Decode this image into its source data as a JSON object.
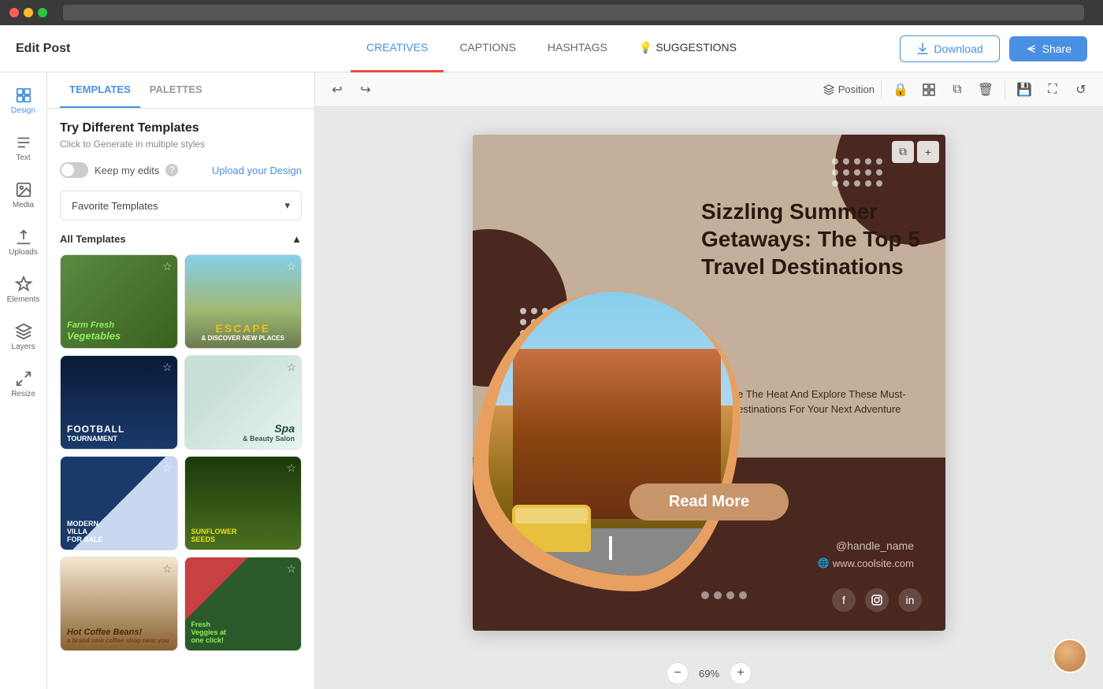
{
  "browser": {
    "dots": [
      "red",
      "yellow",
      "green"
    ]
  },
  "header": {
    "title": "Edit Post",
    "tabs": [
      {
        "label": "CREATIVES",
        "id": "creatives",
        "active": true
      },
      {
        "label": "CAPTIONS",
        "id": "captions",
        "active": false
      },
      {
        "label": "HASHTAGS",
        "id": "hashtags",
        "active": false
      },
      {
        "label": "SUGGESTIONS",
        "id": "suggestions",
        "active": false
      }
    ],
    "download_label": "Download",
    "share_label": "Share"
  },
  "left_panel": {
    "tabs": [
      {
        "label": "TEMPLATES",
        "active": true
      },
      {
        "label": "PALETTES",
        "active": false
      }
    ],
    "try_templates": {
      "title": "Try Different Templates",
      "subtitle": "Click to Generate in multiple styles"
    },
    "keep_edits_label": "Keep my edits",
    "upload_link": "Upload your Design",
    "dropdown": {
      "label": "Favorite Templates",
      "chevron": "▾"
    },
    "all_templates": {
      "label": "All Templates",
      "chevron": "▲"
    },
    "templates": [
      {
        "id": 1,
        "color": "t1",
        "label": "Farm Fresh\nVegetables",
        "star": "☆"
      },
      {
        "id": 2,
        "color": "t2",
        "label": "ESCAPE",
        "star": "☆"
      },
      {
        "id": 3,
        "color": "t3",
        "label": "FOOTBALL\nTOURNAMENT",
        "star": "☆"
      },
      {
        "id": 4,
        "color": "t4",
        "label": "Spa\n& Beauty Salon",
        "star": "☆"
      },
      {
        "id": 5,
        "color": "t5",
        "label": "MODERN\nVILLA\nFOR SALE",
        "star": "☆"
      },
      {
        "id": 6,
        "color": "t6",
        "label": "SUNFLOWER\nSEEDS",
        "star": "☆"
      },
      {
        "id": 7,
        "color": "t7",
        "label": "Hot Coffee Beans!",
        "star": "☆"
      },
      {
        "id": 8,
        "color": "t8",
        "label": "Fresh\nVeggies at\none click!",
        "star": "☆"
      }
    ]
  },
  "toolbar": {
    "position_label": "Position",
    "zoom": {
      "value": "69%",
      "minus": "−",
      "plus": "+"
    }
  },
  "design": {
    "title": "Sizzling Summer Getaways: The Top 5 Travel Destinations",
    "subtitle": "Escape The Heat And Explore These Must-See Destinations For Your Next Adventure",
    "cta_button": "Read More",
    "handle": "@handle_name",
    "website": "www.coolsite.com",
    "social_icons": [
      "f",
      "📷",
      "in"
    ]
  },
  "icons": {
    "sidebar": [
      {
        "name": "design",
        "label": "Design",
        "active": true
      },
      {
        "name": "text",
        "label": "Text",
        "active": false
      },
      {
        "name": "media",
        "label": "Media",
        "active": false
      },
      {
        "name": "uploads",
        "label": "Uploads",
        "active": false
      },
      {
        "name": "elements",
        "label": "Elements",
        "active": false
      },
      {
        "name": "layers",
        "label": "Layers",
        "active": false
      },
      {
        "name": "resize",
        "label": "Resize",
        "active": false
      }
    ]
  }
}
